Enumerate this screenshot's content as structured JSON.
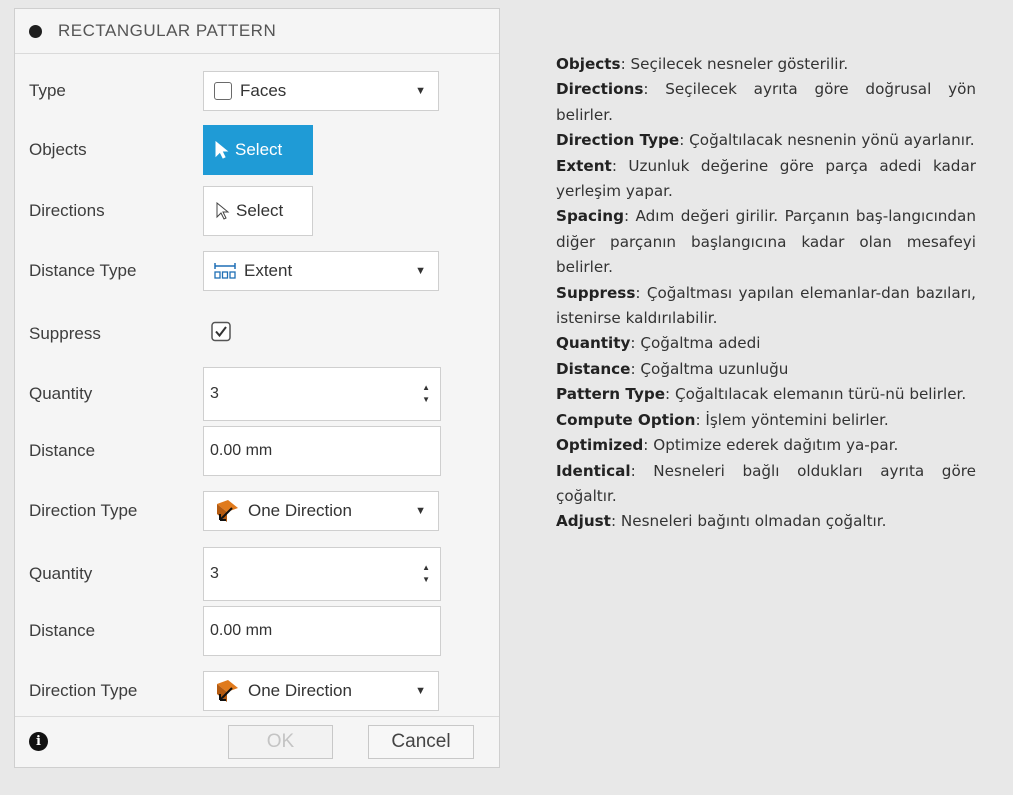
{
  "dialog": {
    "title": "RECTANGULAR PATTERN",
    "rows": [
      {
        "label": "Type",
        "value": "Faces"
      },
      {
        "label": "Objects",
        "value": "Select"
      },
      {
        "label": "Directions",
        "value": "Select"
      },
      {
        "label": "Distance Type",
        "value": "Extent"
      },
      {
        "label": "Suppress",
        "checked": true
      },
      {
        "label": "Quantity",
        "value": "3"
      },
      {
        "label": "Distance",
        "value": "0.00 mm"
      },
      {
        "label": "Direction Type",
        "value": "One Direction"
      },
      {
        "label": "Quantity",
        "value": "3"
      },
      {
        "label": "Distance",
        "value": "0.00 mm"
      },
      {
        "label": "Direction Type",
        "value": "One Direction"
      }
    ],
    "ok_label": "OK",
    "cancel_label": "Cancel",
    "info_icon": "i"
  },
  "descriptions": [
    {
      "term": "Objects",
      "text": ": Seçilecek nesneler gösterilir."
    },
    {
      "term": "Directions",
      "text": ": Seçilecek ayrıta göre doğrusal yön belirler."
    },
    {
      "term": "Direction Type",
      "text": ": Çoğaltılacak nesnenin yönü ayarlanır."
    },
    {
      "term": "Extent",
      "text": ": Uzunluk değerine göre parça adedi kadar yerleşim yapar."
    },
    {
      "term": "Spacing",
      "text": ": Adım değeri girilir. Parçanın baş-langıcından diğer parçanın başlangıcına kadar olan mesafeyi belirler."
    },
    {
      "term": "Suppress",
      "text": ": Çoğaltması yapılan elemanlar-dan bazıları, istenirse kaldırılabilir."
    },
    {
      "term": "Quantity",
      "text": ": Çoğaltma adedi"
    },
    {
      "term": "Distance",
      "text": ": Çoğaltma uzunluğu"
    },
    {
      "term": "Pattern Type",
      "text": ": Çoğaltılacak elemanın türü-nü belirler."
    },
    {
      "term": "Compute Option",
      "text": ": İşlem yöntemini belirler."
    },
    {
      "term": "Optimized",
      "text": ": Optimize ederek dağıtım ya-par."
    },
    {
      "term": "Identical",
      "text": ": Nesneleri bağlı oldukları ayrıta göre çoğaltır."
    },
    {
      "term": "Adjust",
      "text": ": Nesneleri bağıntı olmadan çoğaltır."
    }
  ],
  "colors": {
    "select_active": "#1f9bd6",
    "direction_icon": "#e07a1c"
  }
}
